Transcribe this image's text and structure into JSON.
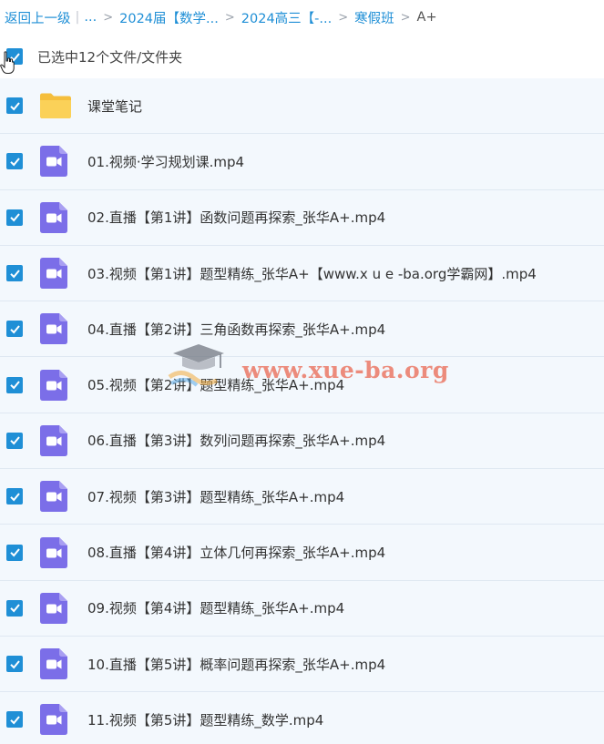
{
  "breadcrumb": {
    "back_label": "返回上一级",
    "ellipsis": "...",
    "items": [
      "2024届【数学...",
      "2024高三【-...",
      "寒假班",
      "A+"
    ]
  },
  "selection": {
    "label": "已选中12个文件/文件夹"
  },
  "files": [
    {
      "name": "课堂笔记",
      "type": "folder"
    },
    {
      "name": "01.视频·学习规划课.mp4",
      "type": "video"
    },
    {
      "name": "02.直播【第1讲】函数问题再探索_张华A+.mp4",
      "type": "video"
    },
    {
      "name": "03.视频【第1讲】题型精练_张华A+【www.x u e -ba.org学霸网】.mp4",
      "type": "video"
    },
    {
      "name": "04.直播【第2讲】三角函数再探索_张华A+.mp4",
      "type": "video"
    },
    {
      "name": "05.视频【第2讲】题型精练_张华A+.mp4",
      "type": "video"
    },
    {
      "name": "06.直播【第3讲】数列问题再探索_张华A+.mp4",
      "type": "video"
    },
    {
      "name": "07.视频【第3讲】题型精练_张华A+.mp4",
      "type": "video"
    },
    {
      "name": "08.直播【第4讲】立体几何再探索_张华A+.mp4",
      "type": "video"
    },
    {
      "name": "09.视频【第4讲】题型精练_张华A+.mp4",
      "type": "video"
    },
    {
      "name": "10.直播【第5讲】概率问题再探索_张华A+.mp4",
      "type": "video"
    },
    {
      "name": "11.视频【第5讲】题型精练_数学.mp4",
      "type": "video"
    }
  ],
  "watermark": {
    "text": "www.xue-ba.org"
  },
  "colors": {
    "link": "#1f8fd6",
    "checkbox": "#1f8fd6",
    "video_icon": "#7b6ee8",
    "folder_icon": "#f7c948",
    "row_background": "#f3f8fd"
  },
  "icons": {
    "checkbox": "checkmark-icon",
    "video": "video-file-icon",
    "folder": "folder-icon",
    "cursor": "hand-cursor-icon"
  }
}
